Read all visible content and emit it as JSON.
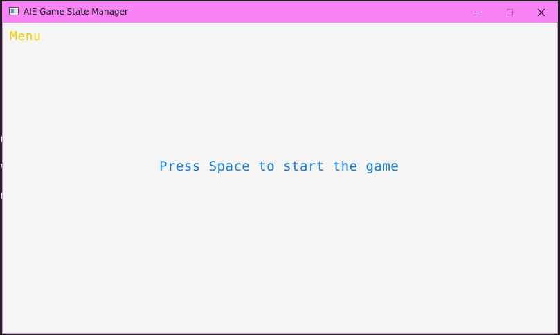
{
  "window": {
    "title": "AIE Game State Manager",
    "icon": "app-window-icon",
    "controls": {
      "minimize_icon": "minimize-icon",
      "maximize_icon": "maximize-icon",
      "close_icon": "close-icon",
      "close_glyph": "✕"
    },
    "titlebar_color": "#f783f7"
  },
  "backdrop": {
    "partial_glyphs": [
      "e",
      "v",
      "o"
    ]
  },
  "game": {
    "state_label": "Menu",
    "state_label_color": "#fbca04",
    "prompt": "Press Space to start the game",
    "prompt_color": "#0f7ae5",
    "background_color": "#f5f5f5"
  }
}
